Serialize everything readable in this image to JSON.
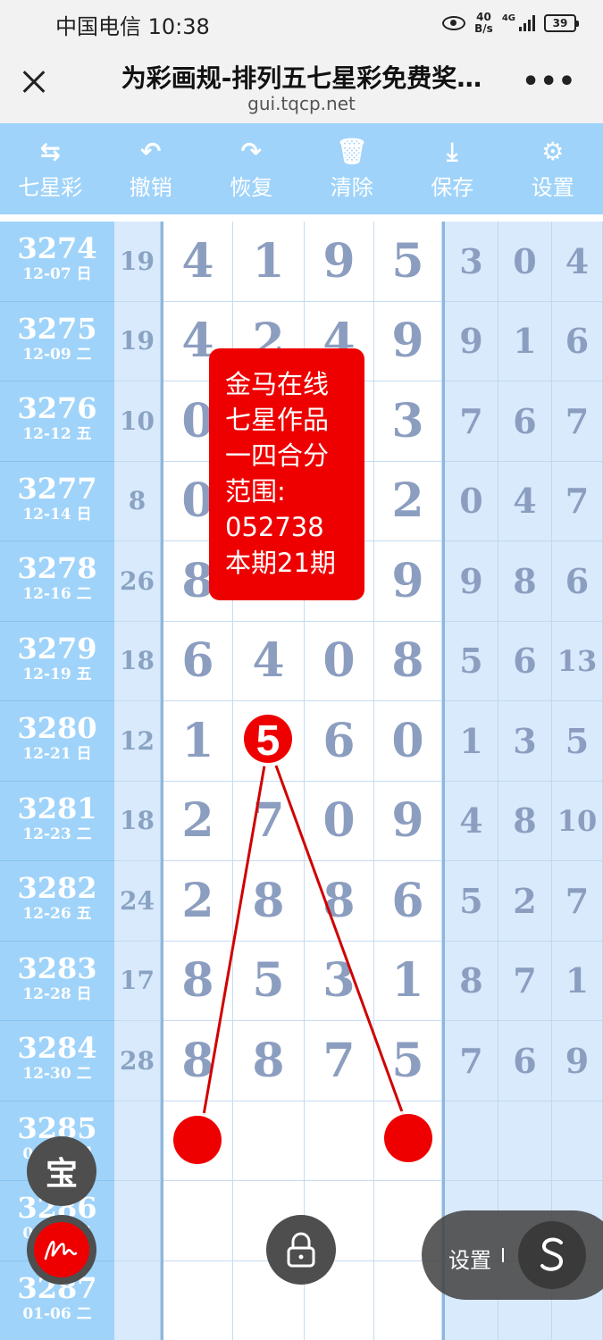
{
  "status_bar": {
    "carrier_time": "中国电信 10:38",
    "speed_value": "40",
    "speed_unit": "B/s",
    "network": "4G",
    "battery": "39"
  },
  "title_bar": {
    "title": "为彩画规-排列五七星彩免费奖…",
    "url": "gui.tqcp.net"
  },
  "toolbar": {
    "items": [
      {
        "label": "七星彩",
        "icon": "swap-icon",
        "glyph": "⇆"
      },
      {
        "label": "撤销",
        "icon": "undo-icon",
        "glyph": "↶"
      },
      {
        "label": "恢复",
        "icon": "redo-icon",
        "glyph": "↷"
      },
      {
        "label": "清除",
        "icon": "trash-icon",
        "glyph": "🗑"
      },
      {
        "label": "保存",
        "icon": "download-icon",
        "glyph": "⤓"
      },
      {
        "label": "设置",
        "icon": "gear-icon",
        "glyph": "⚙"
      }
    ]
  },
  "rows": [
    {
      "issue": "3274",
      "date": "12-07 日",
      "sum": "19",
      "main": [
        "4",
        "1",
        "9",
        "5"
      ],
      "side": [
        "3",
        "0",
        "4"
      ]
    },
    {
      "issue": "3275",
      "date": "12-09 二",
      "sum": "19",
      "main": [
        "4",
        "2",
        "4",
        "9"
      ],
      "side": [
        "9",
        "1",
        "6"
      ]
    },
    {
      "issue": "3276",
      "date": "12-12 五",
      "sum": "10",
      "main": [
        "0",
        "",
        "",
        "3"
      ],
      "side": [
        "7",
        "6",
        "7"
      ]
    },
    {
      "issue": "3277",
      "date": "12-14 日",
      "sum": "8",
      "main": [
        "0",
        "",
        "",
        "2"
      ],
      "side": [
        "0",
        "4",
        "7"
      ]
    },
    {
      "issue": "3278",
      "date": "12-16 二",
      "sum": "26",
      "main": [
        "8",
        "",
        "",
        "9"
      ],
      "side": [
        "9",
        "8",
        "6"
      ]
    },
    {
      "issue": "3279",
      "date": "12-19 五",
      "sum": "18",
      "main": [
        "6",
        "4",
        "0",
        "8"
      ],
      "side": [
        "5",
        "6",
        "13"
      ]
    },
    {
      "issue": "3280",
      "date": "12-21 日",
      "sum": "12",
      "main": [
        "1",
        "",
        "6",
        "0"
      ],
      "side": [
        "1",
        "3",
        "5"
      ]
    },
    {
      "issue": "3281",
      "date": "12-23 二",
      "sum": "18",
      "main": [
        "2",
        "7",
        "0",
        "9"
      ],
      "side": [
        "4",
        "8",
        "10"
      ]
    },
    {
      "issue": "3282",
      "date": "12-26 五",
      "sum": "24",
      "main": [
        "2",
        "8",
        "8",
        "6"
      ],
      "side": [
        "5",
        "2",
        "7"
      ]
    },
    {
      "issue": "3283",
      "date": "12-28 日",
      "sum": "17",
      "main": [
        "8",
        "5",
        "3",
        "1"
      ],
      "side": [
        "8",
        "7",
        "1"
      ]
    },
    {
      "issue": "3284",
      "date": "12-30 二",
      "sum": "28",
      "main": [
        "8",
        "8",
        "7",
        "5"
      ],
      "side": [
        "7",
        "6",
        "9"
      ]
    },
    {
      "issue": "3285",
      "date": "01-01 四",
      "sum": "",
      "main": [
        "",
        "",
        "",
        ""
      ],
      "side": [
        "",
        "",
        ""
      ]
    },
    {
      "issue": "3286",
      "date": "01-04 日",
      "sum": "",
      "main": [
        "",
        "",
        "",
        ""
      ],
      "side": [
        "",
        "",
        ""
      ]
    },
    {
      "issue": "3287",
      "date": "01-06 二",
      "sum": "",
      "main": [
        "",
        "",
        "",
        ""
      ],
      "side": [
        "",
        "",
        ""
      ]
    }
  ],
  "marker": {
    "value": "5",
    "color": "#ee0000"
  },
  "popup": {
    "lines": [
      "金马在线",
      "七星作品",
      "一四合分",
      "范围:",
      "052738",
      "本期21期"
    ],
    "color": "#ee0000"
  },
  "floating": {
    "bao_label": "宝",
    "settings_label": "设置"
  }
}
